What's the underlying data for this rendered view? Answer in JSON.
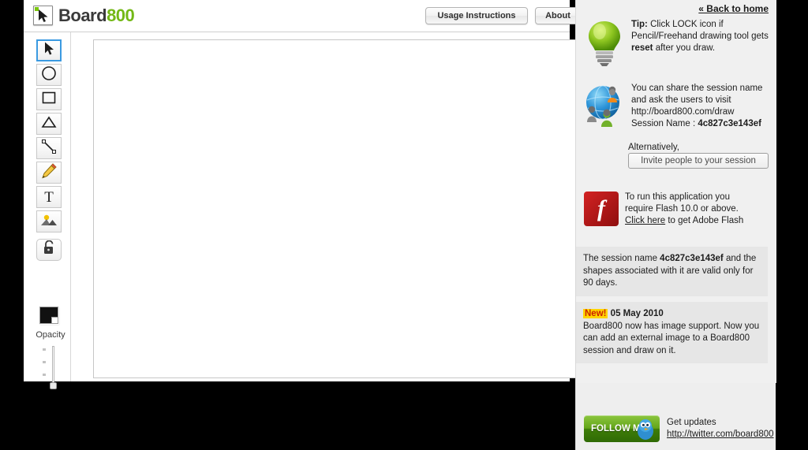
{
  "app": {
    "logo_board": "Board",
    "logo_number": "800",
    "logo_icon": "cursor-logo-icon",
    "buttons": {
      "usage": "Usage Instructions",
      "about": "About"
    }
  },
  "toolbar": {
    "tools": [
      {
        "name": "select-tool",
        "icon": "arrow-cursor-icon",
        "selected": true
      },
      {
        "name": "ellipse-tool",
        "icon": "circle-icon",
        "selected": false
      },
      {
        "name": "rectangle-tool",
        "icon": "square-icon",
        "selected": false
      },
      {
        "name": "triangle-tool",
        "icon": "triangle-icon",
        "selected": false
      },
      {
        "name": "line-tool",
        "icon": "line-icon",
        "selected": false
      },
      {
        "name": "pencil-tool",
        "icon": "pencil-icon",
        "selected": false
      },
      {
        "name": "text-tool",
        "icon": "text-t-icon",
        "selected": false
      },
      {
        "name": "image-tool",
        "icon": "picture-icon",
        "selected": false
      },
      {
        "name": "lock-tool",
        "icon": "padlock-icon",
        "selected": false
      }
    ],
    "color_swatch": "#111111",
    "opacity_label": "Opacity"
  },
  "sidebar": {
    "back_link": "« Back to home",
    "tip": {
      "icon": "lightbulb-icon",
      "label": "Tip:",
      "body_1": " Click LOCK icon if Pencil/Freehand drawing tool gets ",
      "bold_2": "reset",
      "body_2": " after you draw."
    },
    "share": {
      "icon": "globe-people-icon",
      "line1": "You can share the session name",
      "line2": "and ask the users to visit",
      "url": "http://board800.com/draw",
      "session_label": "Session Name : ",
      "session_name": "4c827c3e143ef",
      "alternatively": "Alternatively,",
      "invite_button": "Invite people to your session"
    },
    "flash": {
      "icon": "adobe-flash-icon",
      "glyph": "f",
      "line1": "To run this application you",
      "line2": "require Flash 10.0 or above.",
      "link": "Click here",
      "line3": " to get Adobe Flash"
    },
    "validity": {
      "pre": "The session name ",
      "session_name": "4c827c3e143ef",
      "post": " and the shapes associated with it are valid only for 90 days."
    },
    "news": {
      "badge": "New!",
      "date": " 05 May 2010",
      "body": "Board800 now has image support. Now you can add an external image to a Board800 session and draw on it."
    },
    "twitter": {
      "button_label": "FOLLOW ME",
      "icon": "twitter-bird-icon",
      "get_updates": "Get updates",
      "url": "http://twitter.com/board800"
    }
  }
}
